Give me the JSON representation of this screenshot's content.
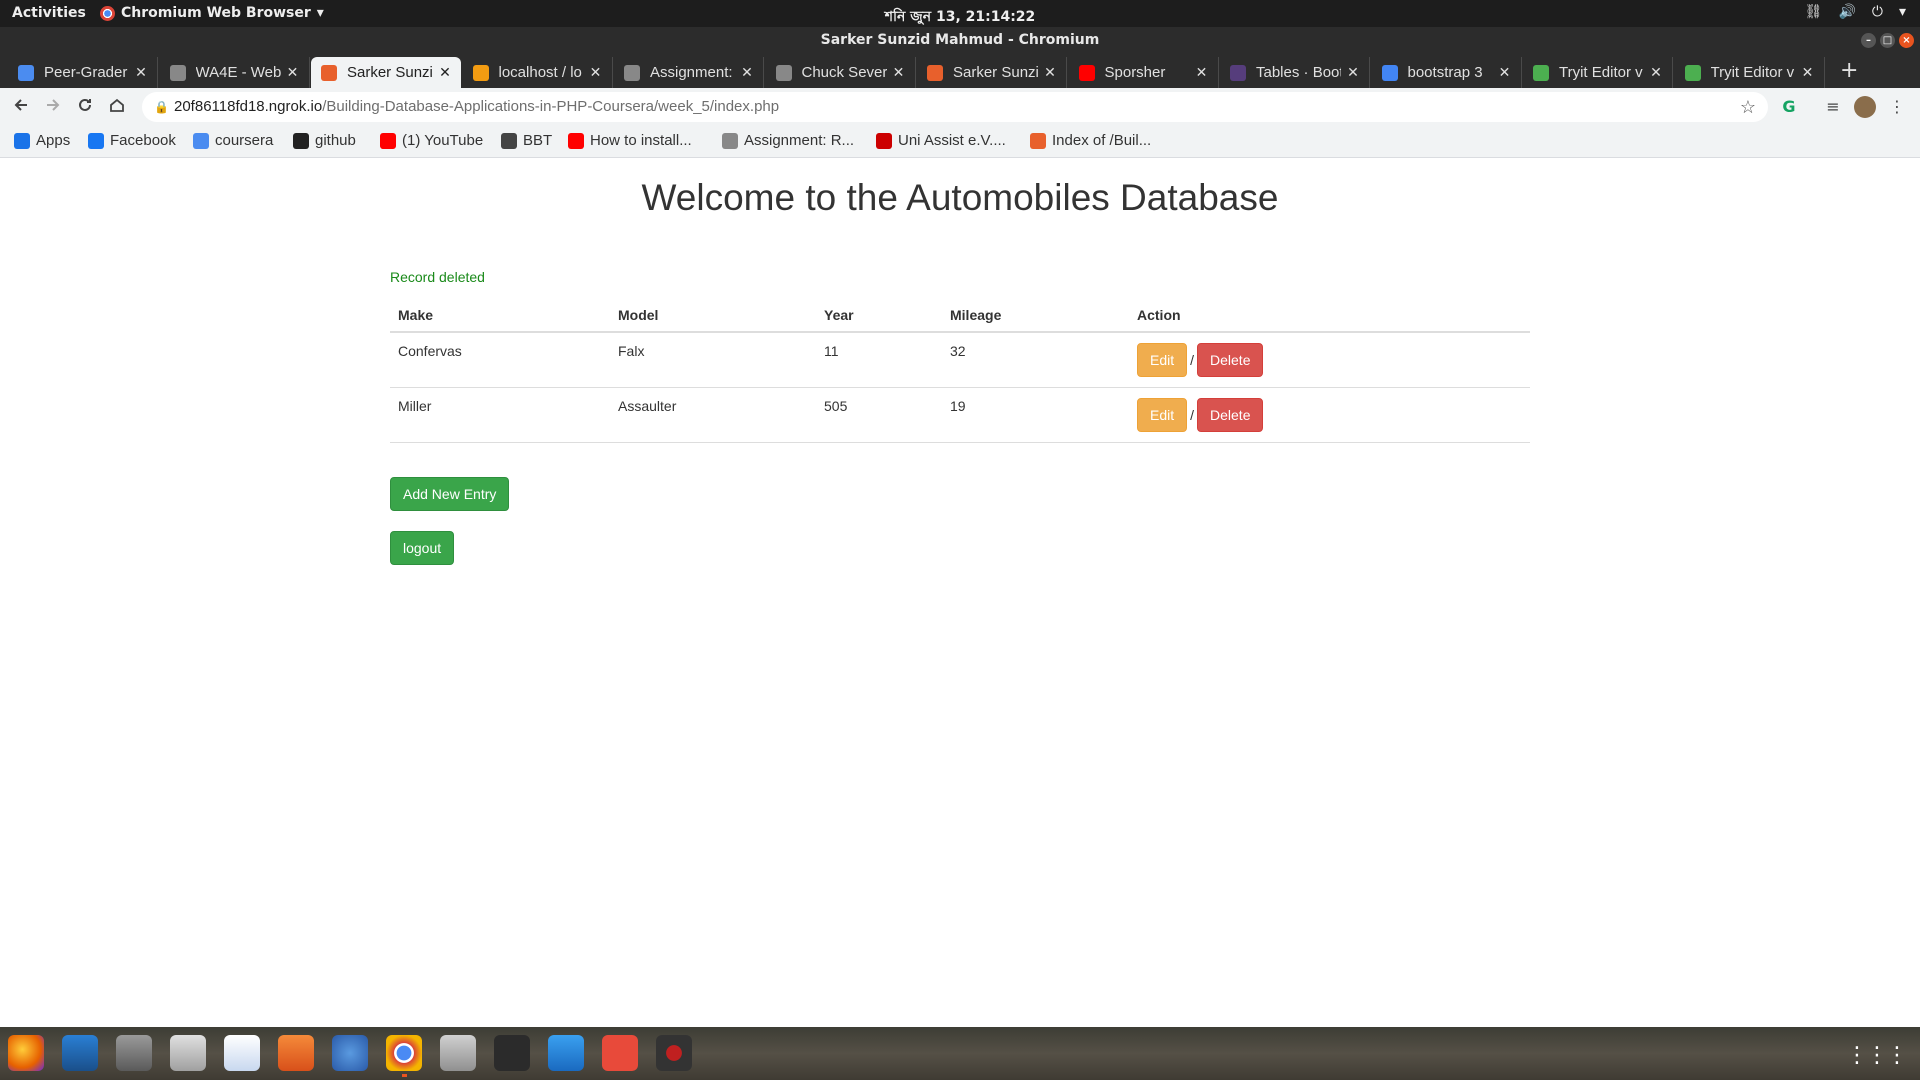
{
  "topbar": {
    "activities": "Activities",
    "app_menu": "Chromium Web Browser",
    "clock": "শনি জুন 13, 21:14:22"
  },
  "window": {
    "title": "Sarker Sunzid Mahmud - Chromium"
  },
  "tabs": [
    {
      "label": "Peer-Grader",
      "icon": "coursera-icon",
      "color": "#4b8cf0"
    },
    {
      "label": "WA4E - Web",
      "icon": "wa4e-icon",
      "color": "#888888"
    },
    {
      "label": "Sarker Sunzid",
      "icon": "page-icon",
      "color": "#e8602c",
      "active": true
    },
    {
      "label": "localhost / lo",
      "icon": "phpmyadmin-icon",
      "color": "#f39c12"
    },
    {
      "label": "Assignment:",
      "icon": "wa4e-icon",
      "color": "#888888"
    },
    {
      "label": "Chuck Severa",
      "icon": "wa4e-icon",
      "color": "#888888"
    },
    {
      "label": "Sarker Sunzid",
      "icon": "page-icon",
      "color": "#e8602c"
    },
    {
      "label": "Sporsher",
      "icon": "youtube-icon",
      "color": "#ff0000"
    },
    {
      "label": "Tables · Boot",
      "icon": "bootstrap-icon",
      "color": "#563d7c"
    },
    {
      "label": "bootstrap 3",
      "icon": "google-icon",
      "color": "#4285f4"
    },
    {
      "label": "Tryit Editor v",
      "icon": "w3schools-icon",
      "color": "#4caf50"
    },
    {
      "label": "Tryit Editor v",
      "icon": "w3schools-icon",
      "color": "#4caf50"
    }
  ],
  "omnibox": {
    "host": "20f86118fd18.ngrok.io",
    "path": "/Building-Database-Applications-in-PHP-Coursera/week_5/index.php"
  },
  "bookmarks": [
    {
      "label": "Apps",
      "icon": "apps-grid-icon",
      "color": "#1a73e8"
    },
    {
      "label": "Facebook",
      "icon": "facebook-icon",
      "color": "#1877f2"
    },
    {
      "label": "coursera",
      "icon": "coursera-icon",
      "color": "#4b8cf0"
    },
    {
      "label": "github",
      "icon": "github-icon",
      "color": "#222222"
    },
    {
      "label": "(1) YouTube",
      "icon": "youtube-icon",
      "color": "#ff0000"
    },
    {
      "label": "BBT",
      "icon": "globe-icon",
      "color": "#444444"
    },
    {
      "label": "How to install...",
      "icon": "youtube-icon",
      "color": "#ff0000"
    },
    {
      "label": "Assignment: R...",
      "icon": "wa4e-icon",
      "color": "#888888"
    },
    {
      "label": "Uni Assist e.V....",
      "icon": "uniassist-icon",
      "color": "#cc0000"
    },
    {
      "label": "Index of /Buil...",
      "icon": "page-icon",
      "color": "#e8602c"
    }
  ],
  "page": {
    "heading": "Welcome to the Automobiles Database",
    "flash": "Record deleted",
    "columns": [
      "Make",
      "Model",
      "Year",
      "Mileage",
      "Action"
    ],
    "rows": [
      {
        "make": "Confervas",
        "model": "Falx",
        "year": "11",
        "mileage": "32"
      },
      {
        "make": "Miller",
        "model": "Assaulter",
        "year": "505",
        "mileage": "19"
      }
    ],
    "edit_label": "Edit",
    "delete_label": "Delete",
    "separator": "/",
    "add_label": "Add New Entry",
    "logout_label": "logout"
  },
  "colors": {
    "flash": "#1a8a1a",
    "edit": "#f0ad4e",
    "delete": "#d9534f",
    "success": "#3aa54a"
  }
}
